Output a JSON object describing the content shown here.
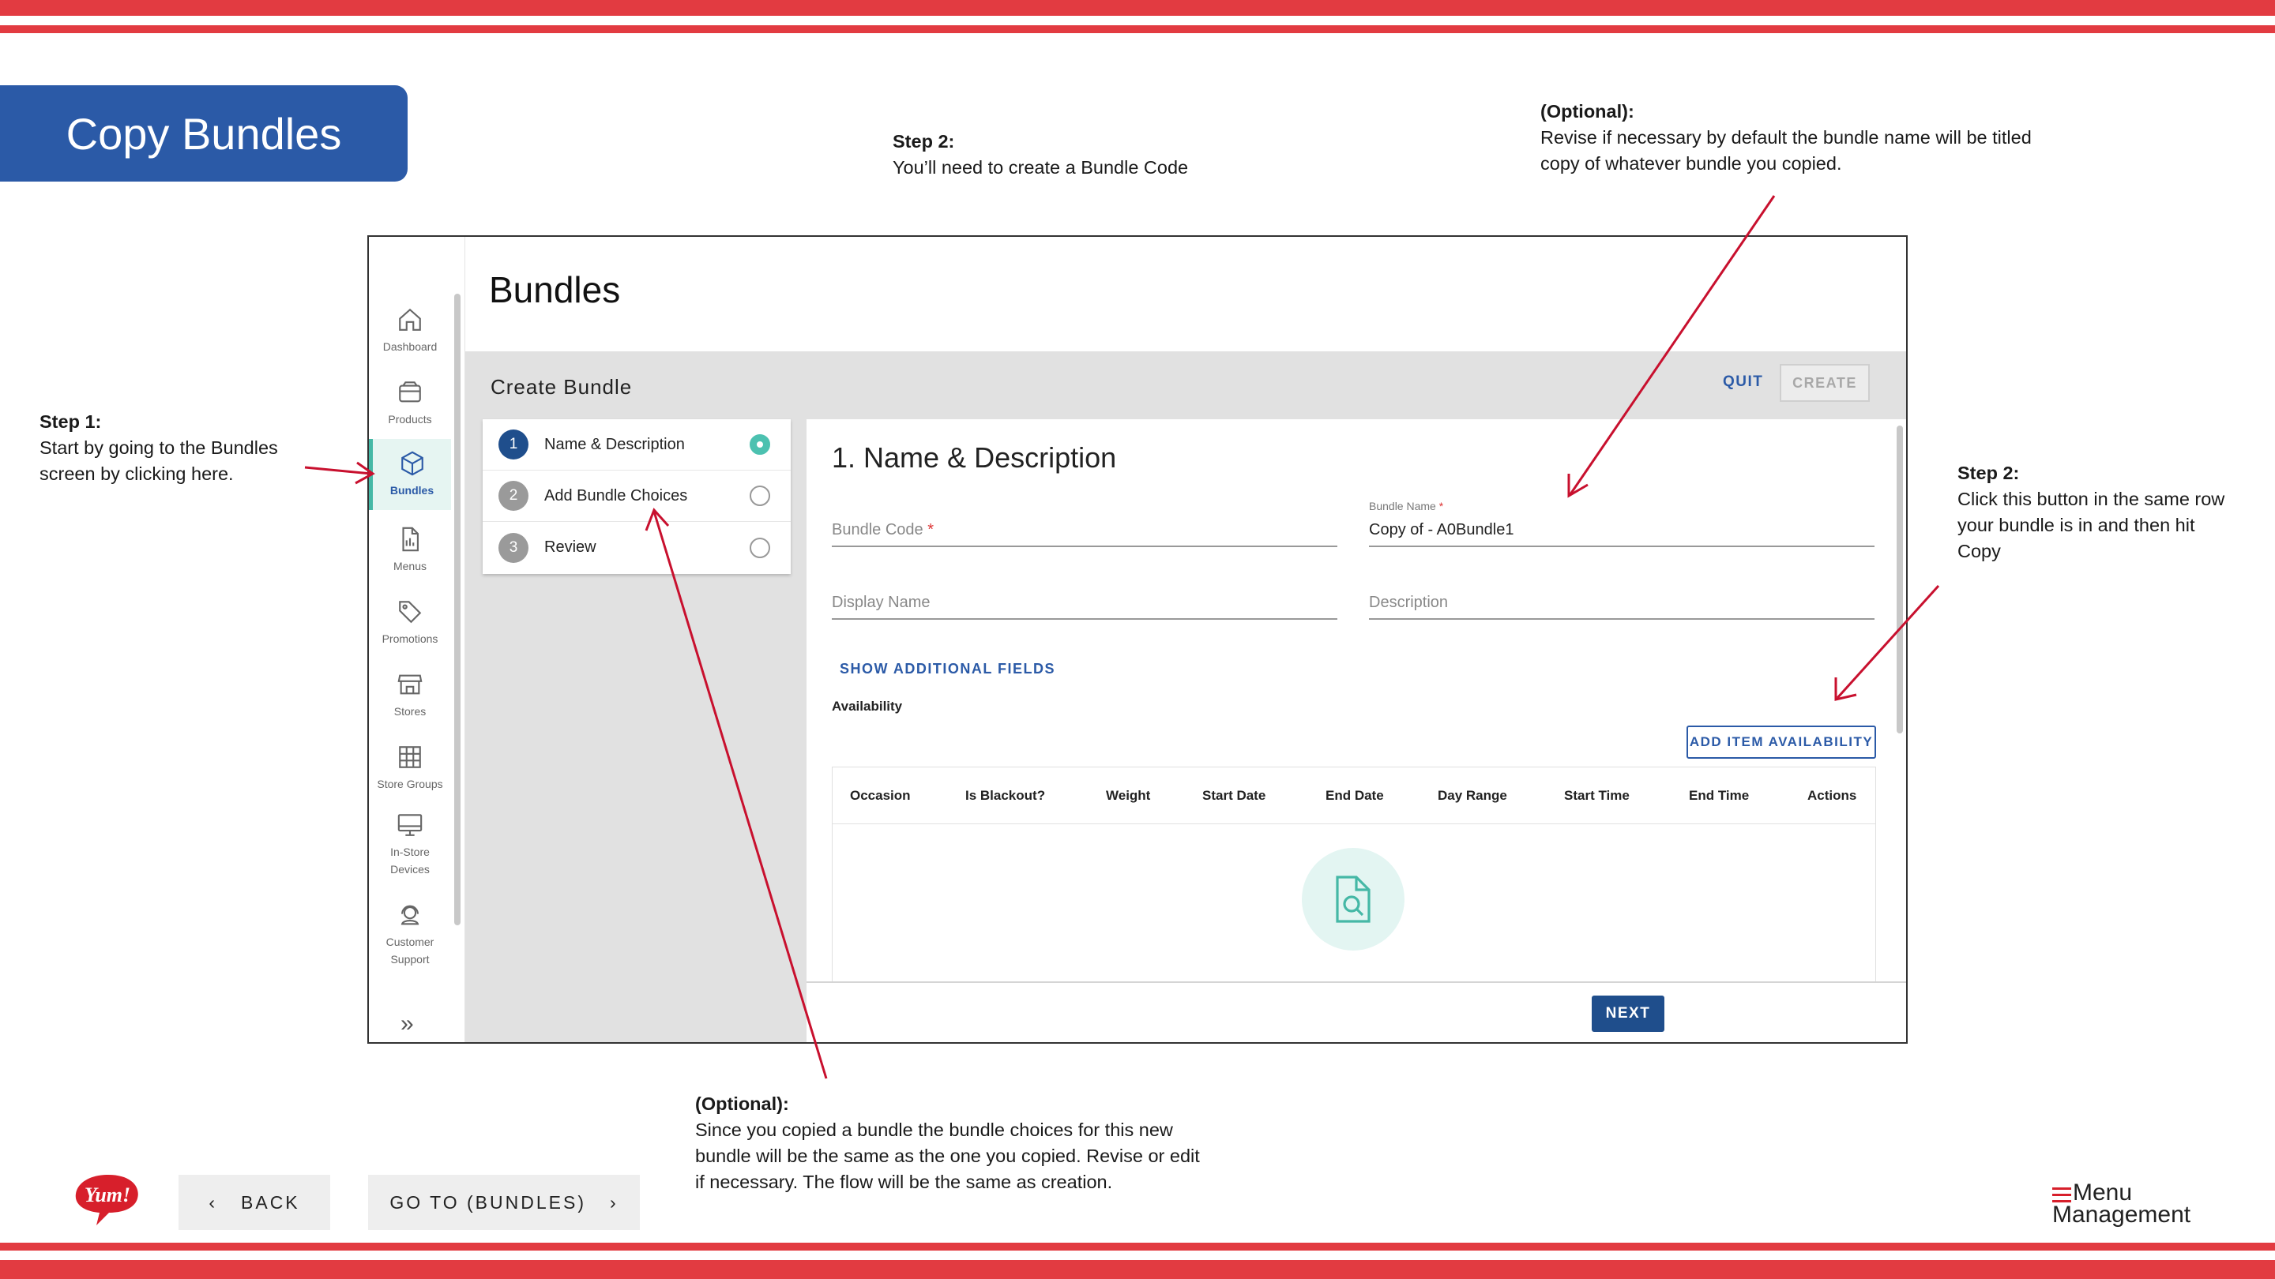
{
  "slide": {
    "title": "Copy Bundles",
    "notes": {
      "step2_code": {
        "heading": "Step 2:",
        "text": "You’ll need to create a Bundle Code"
      },
      "optional_name": {
        "heading": "(Optional):",
        "line1": "Revise if necessary by default the bundle name will be titled",
        "line2": "copy of whatever bundle you copied."
      },
      "step1": {
        "heading": "Step 1:",
        "line1": "Start by going to the Bundles",
        "line2": "screen by clicking here."
      },
      "step2_copy": {
        "heading": "Step 2:",
        "line1": "Click this  button in the same row",
        "line2": "your bundle is in and then hit",
        "line3": "Copy"
      },
      "optional_choices": {
        "heading": "(Optional):",
        "line1": "Since you copied a bundle the bundle choices for this new",
        "line2": "bundle will be the same as the one you copied. Revise or edit",
        "line3": "if necessary. The flow will be the same as creation."
      }
    },
    "nav": {
      "back_label": "BACK",
      "goto_label": "GO TO (BUNDLES)"
    },
    "brand": {
      "yum": "Yum!",
      "mm_line1": "Menu",
      "mm_line2": "Management"
    },
    "colors": {
      "stripe": "#e23b41",
      "title_bg": "#2b5aa7",
      "accent": "#45b8a6",
      "primary": "#1f4e8c"
    }
  },
  "app": {
    "sidebar": {
      "items": [
        {
          "label": "Dashboard",
          "icon": "home-icon"
        },
        {
          "label": "Products",
          "icon": "box-icon"
        },
        {
          "label": "Bundles",
          "icon": "cube-icon",
          "active": true
        },
        {
          "label": "Menus",
          "icon": "document-icon"
        },
        {
          "label": "Promotions",
          "icon": "tag-icon"
        },
        {
          "label": "Stores",
          "icon": "store-icon"
        },
        {
          "label": "Store Groups",
          "icon": "grid-icon"
        },
        {
          "label_line1": "In-Store",
          "label_line2": "Devices",
          "icon": "monitor-icon"
        },
        {
          "label_line1": "Customer",
          "label_line2": "Support",
          "icon": "headset-icon"
        }
      ]
    },
    "page_title": "Bundles",
    "create": {
      "title": "Create Bundle",
      "quit_label": "QUIT",
      "create_label": "CREATE"
    },
    "steps": [
      {
        "num": "1",
        "label": "Name & Description",
        "selected": true
      },
      {
        "num": "2",
        "label": "Add Bundle Choices",
        "selected": false
      },
      {
        "num": "3",
        "label": "Review",
        "selected": false
      }
    ],
    "form": {
      "title": "1. Name & Description",
      "bundle_code_label": "Bundle Code",
      "required_mark": "*",
      "bundle_name_label": "Bundle Name",
      "bundle_name_value": "Copy of - A0Bundle1",
      "display_name_label": "Display Name",
      "description_label": "Description",
      "show_more": "SHOW ADDITIONAL FIELDS",
      "availability_label": "Availability",
      "add_availability": "ADD ITEM AVAILABILITY",
      "columns": [
        "Occasion",
        "Is Blackout?",
        "Weight",
        "Start Date",
        "End Date",
        "Day Range",
        "Start Time",
        "End Time",
        "Actions"
      ],
      "next_label": "NEXT"
    }
  }
}
